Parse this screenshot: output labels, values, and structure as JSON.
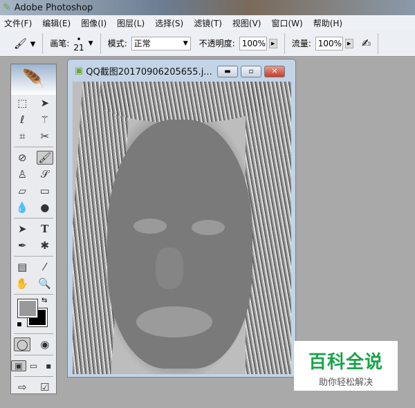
{
  "app": {
    "title": "Adobe Photoshop"
  },
  "menu": [
    "文件(F)",
    "编辑(E)",
    "图像(I)",
    "图层(L)",
    "选择(S)",
    "滤镜(T)",
    "视图(V)",
    "窗口(W)",
    "帮助(H)"
  ],
  "options": {
    "brush_label": "画笔:",
    "brush_size": "21",
    "mode_label": "模式:",
    "mode_value": "正常",
    "opacity_label": "不透明度:",
    "opacity_value": "100%",
    "flow_label": "流量:",
    "flow_value": "100%"
  },
  "document": {
    "title": "QQ截图20170906205655.j..."
  },
  "toolbox": {
    "rows": [
      [
        "marquee-icon",
        "move-icon"
      ],
      [
        "lasso-icon",
        "magic-wand-icon"
      ],
      [
        "crop-icon",
        "slice-icon"
      ],
      [
        "healing-brush-icon",
        "brush-icon"
      ],
      [
        "clone-stamp-icon",
        "history-brush-icon"
      ],
      [
        "eraser-icon",
        "gradient-icon"
      ],
      [
        "blur-icon",
        "dodge-icon"
      ],
      [
        "path-select-icon",
        "type-icon"
      ],
      [
        "pen-icon",
        "custom-shape-icon"
      ],
      [
        "notes-icon",
        "eyedropper-icon"
      ],
      [
        "hand-icon",
        "zoom-icon"
      ]
    ],
    "foreground": "#999999",
    "background": "#000000"
  },
  "watermark": {
    "title": "百科全说",
    "subtitle": "助你轻松解决"
  }
}
